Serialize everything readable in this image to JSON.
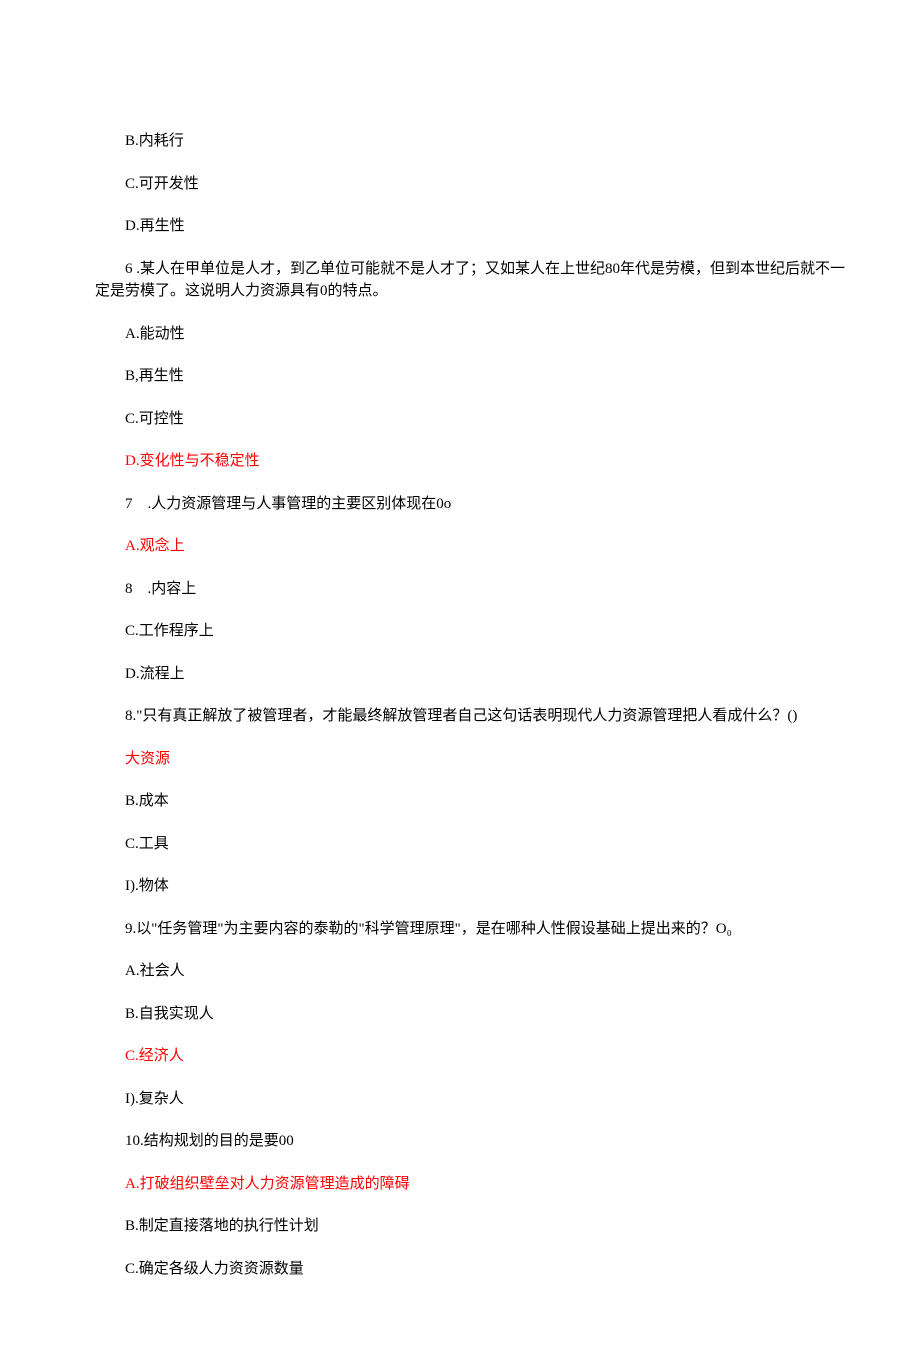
{
  "items": {
    "opt_b_internal": "B.内耗行",
    "opt_c_develop": "C.可开发性",
    "opt_d_regen": "D.再生性",
    "q6": "6 .某人在甲单位是人才，到乙单位可能就不是人才了；又如某人在上世纪80年代是劳模，但到本世纪后就不一定是劳模了。这说明人力资源具有0的特点。",
    "q6_a": "A.能动性",
    "q6_b": "B,再生性",
    "q6_c": "C.可控性",
    "q6_d": "D.变化性与不稳定性",
    "q7": "7    .人力资源管理与人事管理的主要区别体现在0o",
    "q7_a": "A.观念上",
    "q7_b": "8    .内容上",
    "q7_c": "C.工作程序上",
    "q7_d": "D.流程上",
    "q8": "8.\"只有真正解放了被管理者，才能最终解放管理者自己这句话表明现代人力资源管理把人看成什么？()",
    "q8_a": "大资源",
    "q8_b": "B.成本",
    "q8_c": "C.工具",
    "q8_d": "I).物体",
    "q9": "9.以\"任务管理\"为主要内容的泰勒的\"科学管理原理\"，是在哪种人性假设基础上提出来的？O₀",
    "q9_a": "A.社会人",
    "q9_b": "B.自我实现人",
    "q9_c": "C.经济人",
    "q9_d": "I).复杂人",
    "q10": "10.结构规划的目的是要00",
    "q10_a": "A.打破组织壁垒对人力资源管理造成的障碍",
    "q10_b": "B.制定直接落地的执行性计划",
    "q10_c": "C.确定各级人力资资源数量"
  }
}
